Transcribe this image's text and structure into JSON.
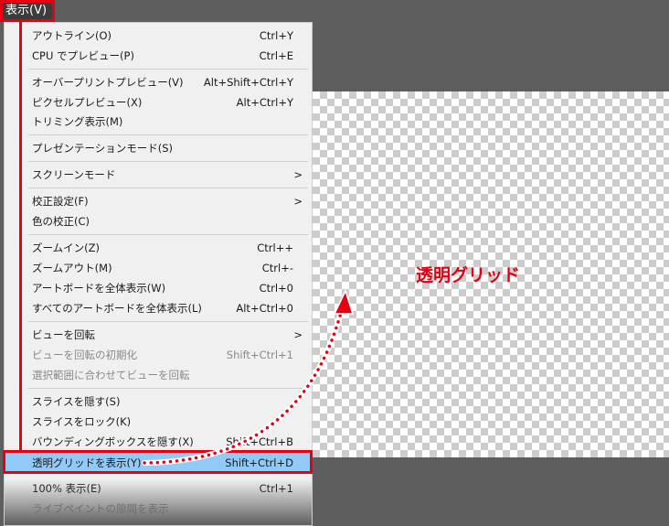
{
  "menubar": {
    "view_menu": "表示(V)"
  },
  "menu": [
    {
      "label": "アウトライン(O)",
      "shortcut": "Ctrl+Y"
    },
    {
      "label": "CPU でプレビュー(P)",
      "shortcut": "Ctrl+E"
    },
    {
      "label": "オーバープリントプレビュー(V)",
      "shortcut": "Alt+Shift+Ctrl+Y"
    },
    {
      "label": "ピクセルプレビュー(X)",
      "shortcut": "Alt+Ctrl+Y"
    },
    {
      "label": "トリミング表示(M)",
      "shortcut": ""
    },
    {
      "label": "プレゼンテーションモード(S)",
      "shortcut": ""
    },
    {
      "label": "スクリーンモード",
      "shortcut": "",
      "submenu": ">"
    },
    {
      "label": "校正設定(F)",
      "shortcut": "",
      "submenu": ">"
    },
    {
      "label": "色の校正(C)",
      "shortcut": ""
    },
    {
      "label": "ズームイン(Z)",
      "shortcut": "Ctrl++"
    },
    {
      "label": "ズームアウト(M)",
      "shortcut": "Ctrl+-"
    },
    {
      "label": "アートボードを全体表示(W)",
      "shortcut": "Ctrl+0"
    },
    {
      "label": "すべてのアートボードを全体表示(L)",
      "shortcut": "Alt+Ctrl+0"
    },
    {
      "label": "ビューを回転",
      "shortcut": "",
      "submenu": ">"
    },
    {
      "label": "ビューを回転の初期化",
      "shortcut": "Shift+Ctrl+1"
    },
    {
      "label": "選択範囲に合わせてビューを回転",
      "shortcut": ""
    },
    {
      "label": "スライスを隠す(S)",
      "shortcut": ""
    },
    {
      "label": "スライスをロック(K)",
      "shortcut": ""
    },
    {
      "label": "バウンディングボックスを隠す(X)",
      "shortcut": "Shift+Ctrl+B"
    },
    {
      "label": "透明グリッドを表示(Y)",
      "shortcut": "Shift+Ctrl+D"
    },
    {
      "label": "100% 表示(E)",
      "shortcut": "Ctrl+1"
    },
    {
      "label": "ライブペイントの隙間を表示",
      "shortcut": ""
    }
  ],
  "annotation": {
    "label": "透明グリッド",
    "color": "#e60012"
  }
}
